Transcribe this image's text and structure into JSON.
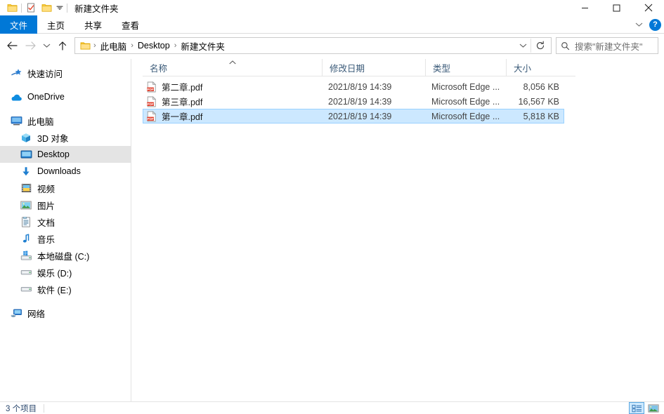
{
  "window": {
    "title": "新建文件夹",
    "quick_access": [
      {
        "name": "folder-icon",
        "label": "文件夹"
      },
      {
        "name": "properties-icon",
        "label": "属性"
      },
      {
        "name": "new-folder-icon",
        "label": "新建文件夹"
      }
    ],
    "qat_dropdown_label": "自定义快速访问工具栏",
    "controls": {
      "minimize": "—",
      "maximize": "□",
      "close": "✕"
    }
  },
  "ribbon": {
    "tabs": [
      {
        "label": "文件",
        "active": true
      },
      {
        "label": "主页",
        "active": false
      },
      {
        "label": "共享",
        "active": false
      },
      {
        "label": "查看",
        "active": false
      }
    ],
    "collapse_label": "⌄",
    "help_label": "?"
  },
  "address": {
    "back_label": "←",
    "forward_label": "→",
    "recent_label": "⌄",
    "up_label": "↑",
    "crumbs": [
      "此电脑",
      "Desktop",
      "新建文件夹"
    ],
    "separator": "›",
    "dropdown_label": "⌄",
    "refresh_label": "↻"
  },
  "search": {
    "placeholder": "搜索\"新建文件夹\"",
    "icon": "search-icon"
  },
  "sidebar": {
    "items": [
      {
        "label": "快速访问",
        "icon": "quick-access-star-icon",
        "indent": 0,
        "selected": false
      },
      {
        "label": "OneDrive",
        "icon": "onedrive-cloud-icon",
        "indent": 0,
        "selected": false
      },
      {
        "label": "此电脑",
        "icon": "this-pc-monitor-icon",
        "indent": 0,
        "selected": false
      },
      {
        "label": "3D 对象",
        "icon": "3d-objects-icon",
        "indent": 1,
        "selected": false
      },
      {
        "label": "Desktop",
        "icon": "desktop-icon",
        "indent": 1,
        "selected": true
      },
      {
        "label": "Downloads",
        "icon": "downloads-arrow-icon",
        "indent": 1,
        "selected": false
      },
      {
        "label": "视频",
        "icon": "videos-icon",
        "indent": 1,
        "selected": false
      },
      {
        "label": "图片",
        "icon": "pictures-icon",
        "indent": 1,
        "selected": false
      },
      {
        "label": "文档",
        "icon": "documents-icon",
        "indent": 1,
        "selected": false
      },
      {
        "label": "音乐",
        "icon": "music-note-icon",
        "indent": 1,
        "selected": false
      },
      {
        "label": "本地磁盘 (C:)",
        "icon": "system-drive-icon",
        "indent": 1,
        "selected": false
      },
      {
        "label": "娱乐 (D:)",
        "icon": "drive-icon",
        "indent": 1,
        "selected": false
      },
      {
        "label": "软件 (E:)",
        "icon": "drive-icon",
        "indent": 1,
        "selected": false
      },
      {
        "label": "网络",
        "icon": "network-icon",
        "indent": 0,
        "selected": false
      }
    ]
  },
  "filelist": {
    "columns": [
      {
        "label": "名称",
        "sorted": true,
        "sort_dir": "asc"
      },
      {
        "label": "修改日期",
        "sorted": false
      },
      {
        "label": "类型",
        "sorted": false
      },
      {
        "label": "大小",
        "sorted": false
      }
    ],
    "sort_caret": "︿",
    "rows": [
      {
        "name": "第二章.pdf",
        "date": "2021/8/19 14:39",
        "type": "Microsoft Edge ...",
        "size": "8,056 KB",
        "icon": "pdf-file-icon",
        "selected": false
      },
      {
        "name": "第三章.pdf",
        "date": "2021/8/19 14:39",
        "type": "Microsoft Edge ...",
        "size": "16,567 KB",
        "icon": "pdf-file-icon",
        "selected": false
      },
      {
        "name": "第一章.pdf",
        "date": "2021/8/19 14:39",
        "type": "Microsoft Edge ...",
        "size": "5,818 KB",
        "icon": "pdf-file-icon",
        "selected": true
      }
    ]
  },
  "statusbar": {
    "item_count": "3 个项目",
    "views": [
      {
        "name": "details-view",
        "active": true
      },
      {
        "name": "large-icons-view",
        "active": false
      }
    ]
  },
  "colors": {
    "accent": "#0078d7",
    "selection_bg": "#cce8ff",
    "selection_border": "#99d1ff",
    "nav_selection": "#e4e4e4",
    "header_text": "#3a5a78",
    "folder_yellow": "#ffd966",
    "pdf_red": "#e03a27"
  }
}
